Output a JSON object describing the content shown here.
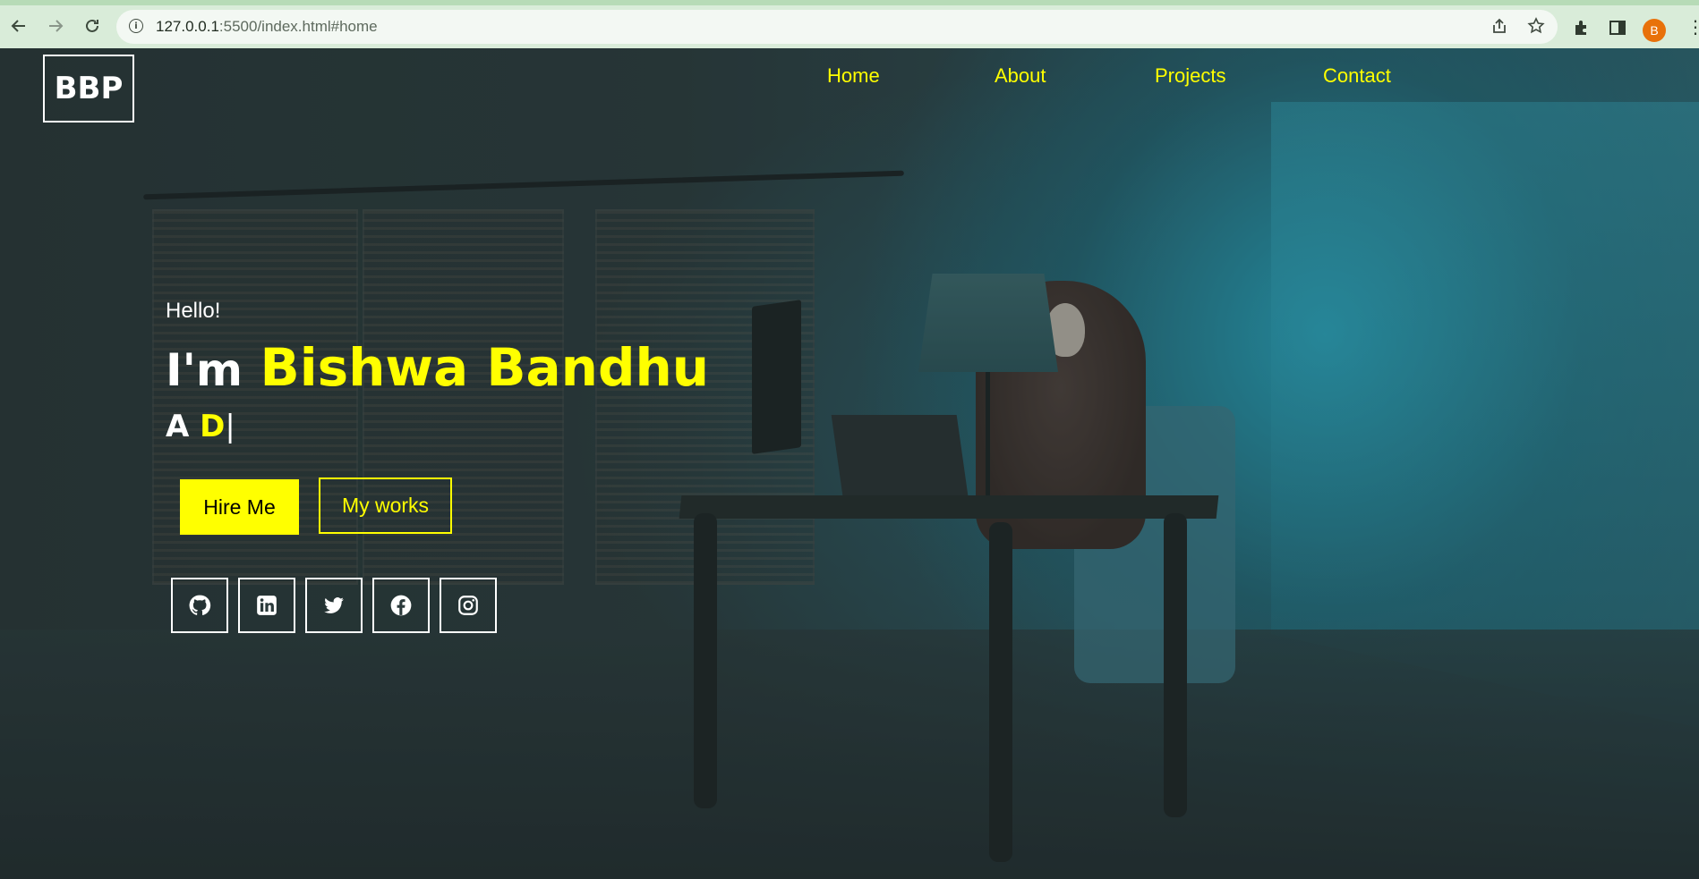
{
  "browser": {
    "url_host": "127.0.0.1",
    "url_rest": ":5500/index.html#home",
    "profile_initial": "B"
  },
  "site": {
    "logo": "BBP",
    "nav": [
      "Home",
      "About",
      "Projects",
      "Contact"
    ]
  },
  "hero": {
    "greeting": "Hello!",
    "intro": "I'm",
    "name": "Bishwa Bandhu",
    "typed_prefix": "A",
    "typed_text": "D",
    "cursor": "|",
    "hire_label": "Hire Me",
    "works_label": "My works"
  },
  "social": [
    "github-icon",
    "linkedin-icon",
    "twitter-icon",
    "facebook-icon",
    "instagram-icon"
  ],
  "colors": {
    "accent": "#ffff00",
    "text": "#ffffff",
    "chrome_bg": "#d9ecd9"
  }
}
